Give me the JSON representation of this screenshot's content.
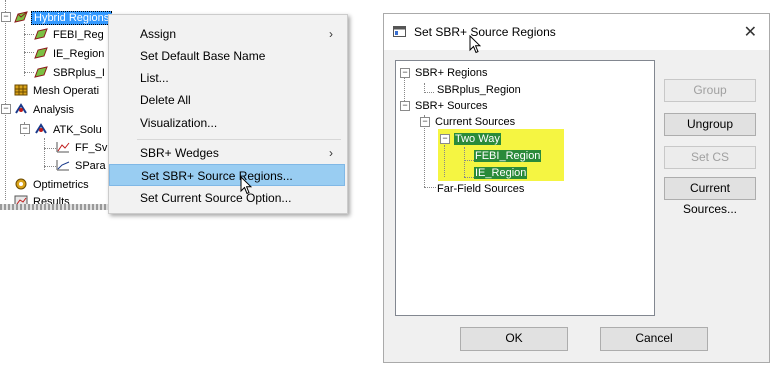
{
  "tree": {
    "items": [
      {
        "label": "Hybrid Regions"
      },
      {
        "label": "FEBI_Reg"
      },
      {
        "label": "IE_Region"
      },
      {
        "label": "SBRplus_I"
      },
      {
        "label": "Mesh Operati"
      },
      {
        "label": "Analysis"
      },
      {
        "label": "ATK_Solu"
      },
      {
        "label": "FF_Sv"
      },
      {
        "label": "SPara"
      },
      {
        "label": "Optimetrics"
      },
      {
        "label": "Results"
      }
    ]
  },
  "context_menu": {
    "items": [
      {
        "label": "Assign",
        "submenu": true
      },
      {
        "label": "Set Default Base Name"
      },
      {
        "label": "List..."
      },
      {
        "label": "Delete All"
      },
      {
        "label": "Visualization..."
      },
      {
        "label": "SBR+ Wedges",
        "submenu": true
      },
      {
        "label": "Set SBR+ Source Regions...",
        "highlighted": true
      },
      {
        "label": "Set Current Source Option..."
      }
    ],
    "submenu_arrow": "›",
    "highlight_color": "#99cdf2"
  },
  "dialog": {
    "title": "Set SBR+ Source Regions",
    "close_glyph": "✕",
    "tree": {
      "items": [
        {
          "label": "SBR+ Regions"
        },
        {
          "label": "SBRplus_Region"
        },
        {
          "label": "SBR+ Sources"
        },
        {
          "label": "Current Sources"
        },
        {
          "label": "Two Way"
        },
        {
          "label": "FEBI_Region"
        },
        {
          "label": "IE_Region"
        },
        {
          "label": "Far-Field Sources"
        }
      ],
      "highlight_color": "#f5f542",
      "selected_color": "#2a8a3a"
    },
    "buttons": {
      "group": "Group",
      "ungroup": "Ungroup",
      "set_cs": "Set CS",
      "current_sources": "Current Sources...",
      "ok": "OK",
      "cancel": "Cancel"
    }
  }
}
